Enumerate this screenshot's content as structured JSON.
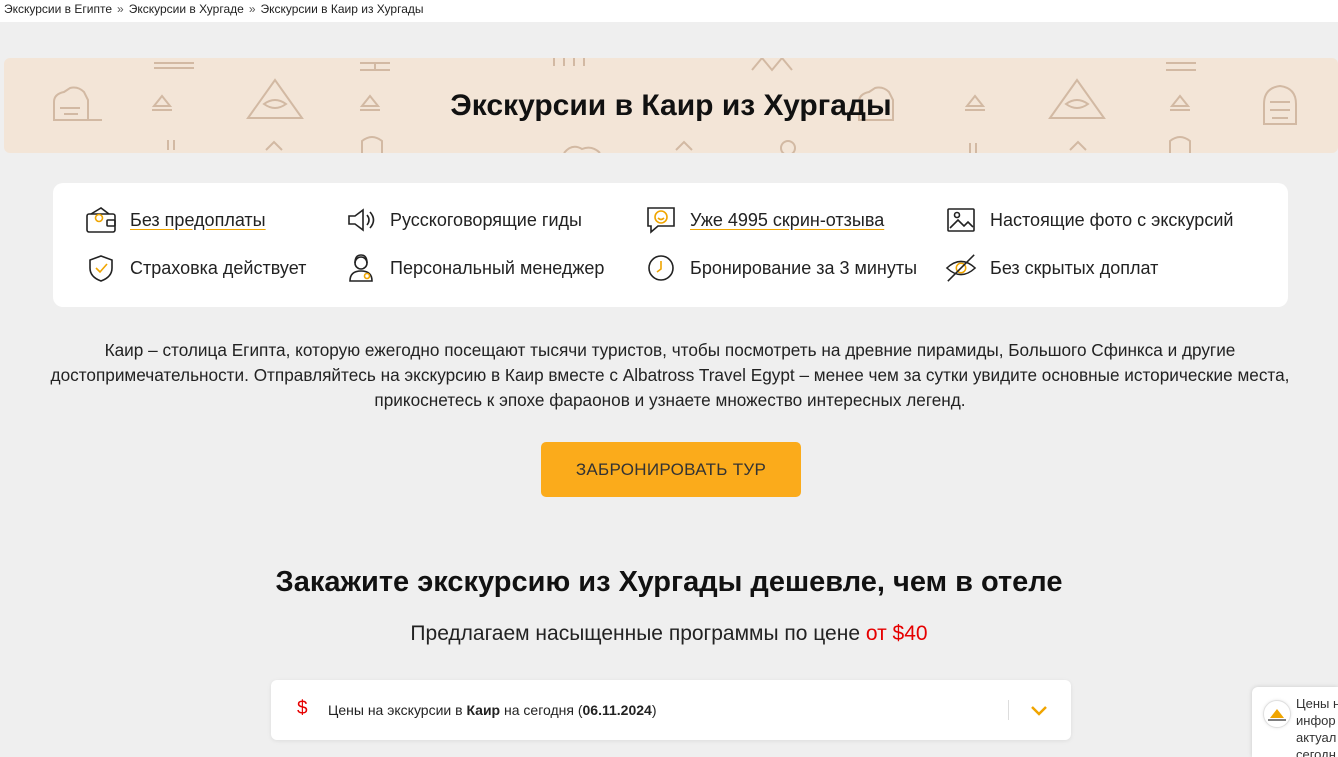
{
  "breadcrumb": {
    "items": [
      "Экскурсии в Египте",
      "Экскурсии в Хургаде",
      "Экскурсии в Каир из Хургады"
    ],
    "separator": "»"
  },
  "banner": {
    "title": "Экскурсии в Каир из Хургады"
  },
  "features": [
    {
      "label": "Без предоплаты",
      "icon": "wallet-icon",
      "link": true
    },
    {
      "label": "Русскоговорящие гиды",
      "icon": "speaker-icon",
      "link": false
    },
    {
      "label": "Уже 4995 скрин-отзыва",
      "icon": "review-chat-icon",
      "link": true
    },
    {
      "label": "Настоящие фото с экскурсий",
      "icon": "photo-icon",
      "link": false
    },
    {
      "label": "Страховка действует",
      "icon": "shield-check-icon",
      "link": false
    },
    {
      "label": "Персональный менеджер",
      "icon": "manager-icon",
      "link": false
    },
    {
      "label": "Бронирование за 3 минуты",
      "icon": "clock-icon",
      "link": false
    },
    {
      "label": "Без скрытых доплат",
      "icon": "eye-crossed-icon",
      "link": false
    }
  ],
  "description": "Каир – столица Египта, которую ежегодно посещают тысячи туристов, чтобы посмотреть на древние пирамиды, Большого Сфинкса и другие достопримечательности. Отправляйтесь на экскурсию в Каир вместе с Albatross Travel Egypt – менее чем за сутки увидите основные исторические места, прикоснетесь к эпохе фараонов и узнаете множество интересных легенд.",
  "cta": {
    "label": "ЗАБРОНИРОВАТЬ ТУР"
  },
  "offer": {
    "title": "Закажите экскурсию из Хургады дешевле, чем в отеле",
    "subtitle_prefix": "Предлагаем насыщенные программы по цене",
    "subtitle_price": "от $40"
  },
  "pricebar": {
    "icon_symbol": "$",
    "text_part1": "Цены на экскурсии в",
    "text_bold1": "Каир",
    "text_part2": "на сегодня (",
    "text_date": "06.11.2024",
    "text_part3": ")"
  },
  "notice": {
    "lines": [
      "Цены н",
      "инфор",
      "актуал",
      "сегодн"
    ]
  },
  "colors": {
    "accent": "#fbab1b",
    "price_red": "#e60000",
    "banner_bg": "#f3e5d7",
    "icon_stroke": "#222222"
  }
}
